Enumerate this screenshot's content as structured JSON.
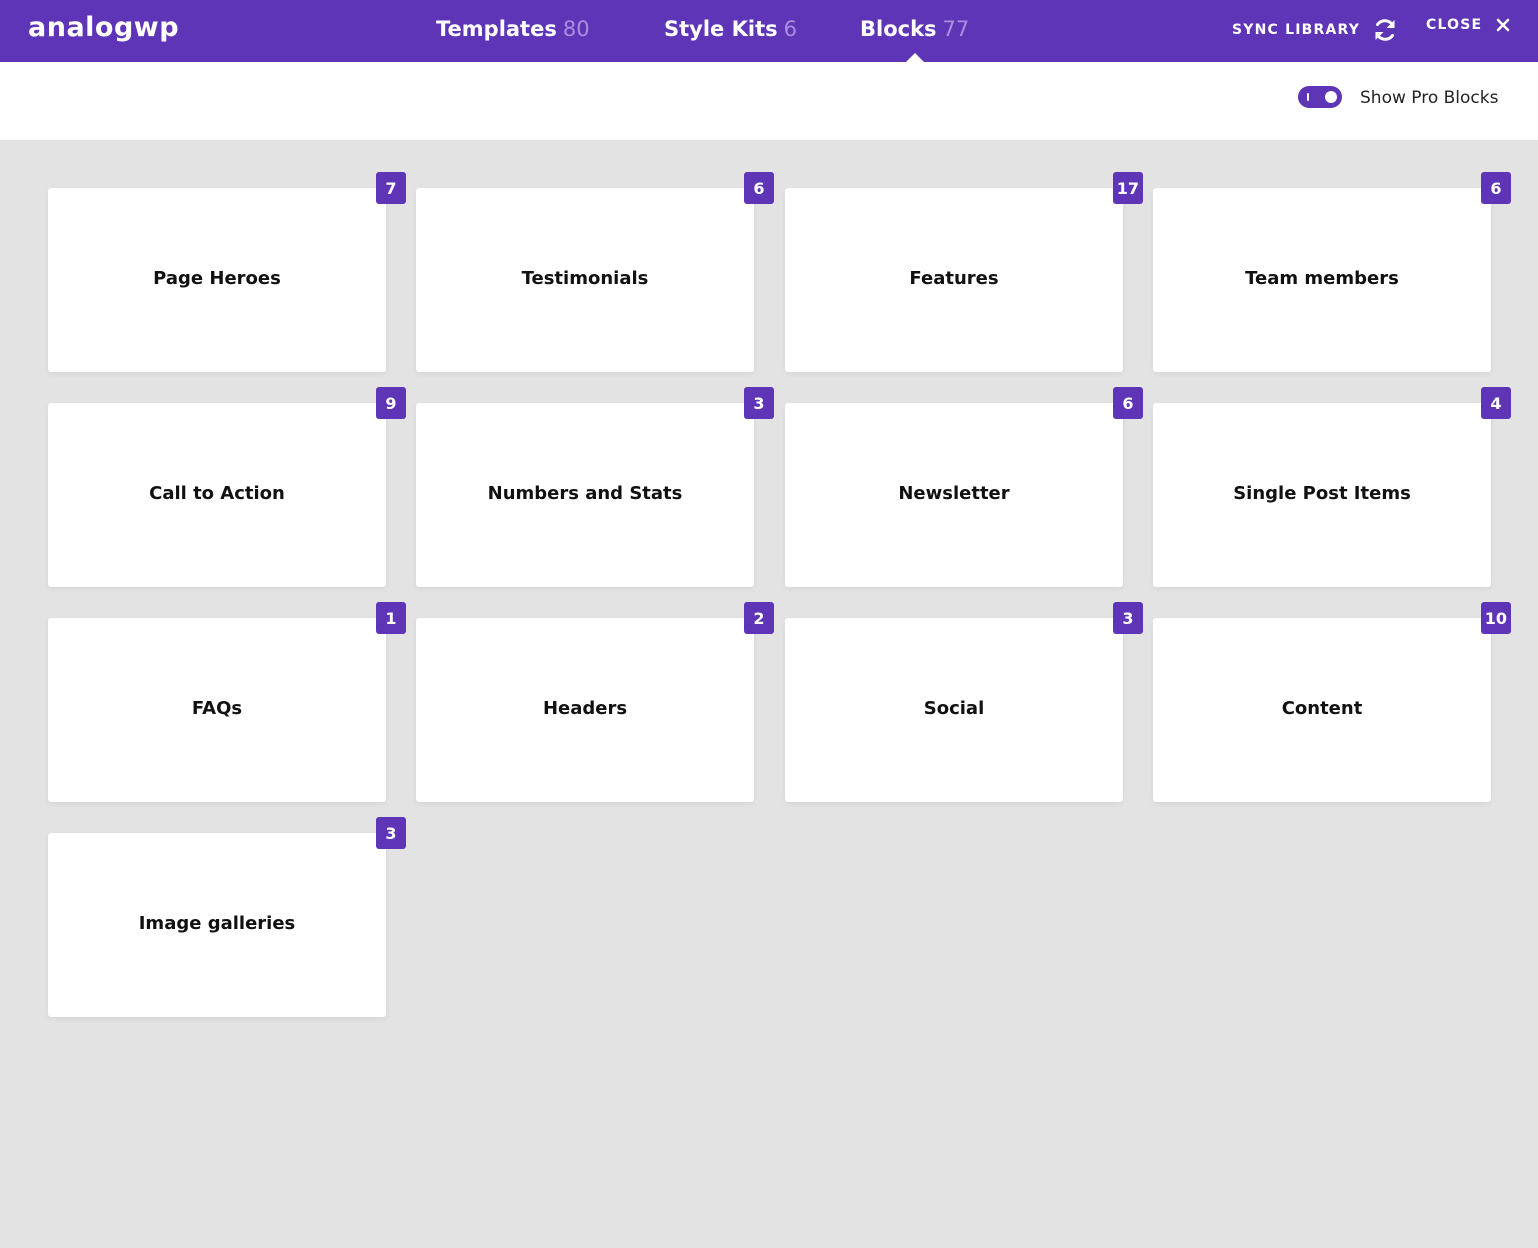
{
  "header": {
    "logo": "analogwp",
    "tabs": [
      {
        "label": "Templates",
        "count": "80"
      },
      {
        "label": "Style Kits",
        "count": "6"
      },
      {
        "label": "Blocks",
        "count": "77"
      }
    ],
    "sync_label": "SYNC LIBRARY",
    "close_label": "CLOSE"
  },
  "subbar": {
    "toggle_label": "Show Pro Blocks",
    "toggle_on": true
  },
  "colors": {
    "accent": "#5f35b8",
    "background": "#e3e3e3"
  },
  "blocks": [
    {
      "title": "Page Heroes",
      "count": "7"
    },
    {
      "title": "Testimonials",
      "count": "6"
    },
    {
      "title": "Features",
      "count": "17"
    },
    {
      "title": "Team members",
      "count": "6"
    },
    {
      "title": "Call to Action",
      "count": "9"
    },
    {
      "title": "Numbers and Stats",
      "count": "3"
    },
    {
      "title": "Newsletter",
      "count": "6"
    },
    {
      "title": "Single Post Items",
      "count": "4"
    },
    {
      "title": "FAQs",
      "count": "1"
    },
    {
      "title": "Headers",
      "count": "2"
    },
    {
      "title": "Social",
      "count": "3"
    },
    {
      "title": "Content",
      "count": "10"
    },
    {
      "title": "Image galleries",
      "count": "3"
    }
  ]
}
